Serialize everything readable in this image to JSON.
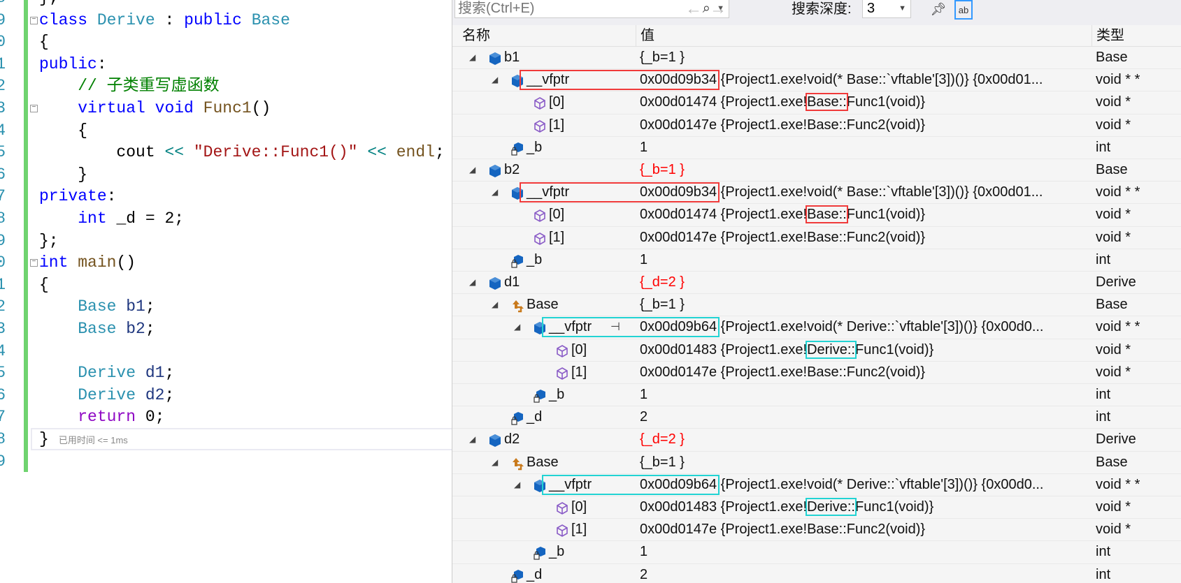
{
  "editor": {
    "line_numbers": [
      "8",
      "9",
      "0",
      "1",
      "2",
      "3",
      "4",
      "5",
      "6",
      "7",
      "8",
      "9",
      "0",
      "1",
      "2",
      "3",
      "4",
      "5",
      "6",
      "7",
      "8",
      "9"
    ],
    "fold_lines": [
      1,
      5,
      12
    ],
    "timing_hint": "已用时间 <= 1ms",
    "lines": [
      [
        [
          "pl",
          "};"
        ]
      ],
      [
        [
          "kw",
          "class "
        ],
        [
          "ty",
          "Derive"
        ],
        [
          "pl",
          " : "
        ],
        [
          "kw",
          "public "
        ],
        [
          "ty",
          "Base"
        ]
      ],
      [
        [
          "pl",
          "{"
        ]
      ],
      [
        [
          "kw",
          "public"
        ],
        [
          "pl",
          ":"
        ]
      ],
      [
        [
          "pl",
          "    "
        ],
        [
          "cm",
          "// 子类重写虚函数"
        ]
      ],
      [
        [
          "pl",
          "    "
        ],
        [
          "kw",
          "virtual void "
        ],
        [
          "fn",
          "Func1"
        ],
        [
          "pl",
          "()"
        ]
      ],
      [
        [
          "pl",
          "    {"
        ]
      ],
      [
        [
          "pl",
          "        cout "
        ],
        [
          "op",
          "<<"
        ],
        [
          "pl",
          " "
        ],
        [
          "st",
          "\"Derive::Func1()\""
        ],
        [
          "pl",
          " "
        ],
        [
          "op",
          "<<"
        ],
        [
          "pl",
          " "
        ],
        [
          "fn",
          "endl"
        ],
        [
          "pl",
          ";"
        ]
      ],
      [
        [
          "pl",
          "    }"
        ]
      ],
      [
        [
          "kw",
          "private"
        ],
        [
          "pl",
          ":"
        ]
      ],
      [
        [
          "pl",
          "    "
        ],
        [
          "kw",
          "int "
        ],
        [
          "pl",
          "_d = 2;"
        ]
      ],
      [
        [
          "pl",
          "};"
        ]
      ],
      [
        [
          "kw",
          "int "
        ],
        [
          "fn",
          "main"
        ],
        [
          "pl",
          "()"
        ]
      ],
      [
        [
          "pl",
          "{"
        ]
      ],
      [
        [
          "pl",
          "    "
        ],
        [
          "ty",
          "Base "
        ],
        [
          "va",
          "b1"
        ],
        [
          "pl",
          ";"
        ]
      ],
      [
        [
          "pl",
          "    "
        ],
        [
          "ty",
          "Base "
        ],
        [
          "va",
          "b2"
        ],
        [
          "pl",
          ";"
        ]
      ],
      [],
      [
        [
          "pl",
          "    "
        ],
        [
          "ty",
          "Derive "
        ],
        [
          "va",
          "d1"
        ],
        [
          "pl",
          ";"
        ]
      ],
      [
        [
          "pl",
          "    "
        ],
        [
          "ty",
          "Derive "
        ],
        [
          "va",
          "d2"
        ],
        [
          "pl",
          ";"
        ]
      ],
      [
        [
          "pl",
          "    "
        ],
        [
          "rt",
          "return "
        ],
        [
          "pl",
          "0;"
        ]
      ],
      [
        [
          "pl",
          "}"
        ]
      ],
      []
    ]
  },
  "toolbar": {
    "search_placeholder": "搜索(Ctrl+E)",
    "search_icon": "search-icon",
    "back_icon": "←",
    "forward_icon": "→",
    "depth_label": "搜索深度:",
    "depth_value": "3"
  },
  "columns": {
    "name": "名称",
    "value": "值",
    "type": "类型"
  },
  "colors": {
    "red_box": "#f03a3a",
    "cyan_box": "#22d3d3",
    "changed_value": "#ff0000"
  },
  "rows": [
    {
      "level": 0,
      "expand": true,
      "icon": "object",
      "name": "b1",
      "value": "{_b=1 }",
      "type": "Base"
    },
    {
      "level": 1,
      "expand": true,
      "icon": "object",
      "name": "__vfptr",
      "addr": "0x00d09b34",
      "rest": " {Project1.exe!void(* Base::`vftable'[3])()} {0x00d01...",
      "type": "void * *",
      "box": "red"
    },
    {
      "level": 2,
      "expand": false,
      "icon": "function",
      "name": "[0]",
      "addr": "0x00d01474",
      "pre": " {Project1.exe!",
      "mark": "Base::",
      "post": "Func1(void)}",
      "type": "void *",
      "mark_color": "red"
    },
    {
      "level": 2,
      "expand": false,
      "icon": "function",
      "name": "[1]",
      "value": "0x00d0147e {Project1.exe!Base::Func2(void)}",
      "type": "void *"
    },
    {
      "level": 1,
      "expand": false,
      "icon": "private-field",
      "name": "_b",
      "value": "1",
      "type": "int"
    },
    {
      "level": 0,
      "expand": true,
      "icon": "object",
      "name": "b2",
      "value": "{_b=1 }",
      "type": "Base",
      "changed": true
    },
    {
      "level": 1,
      "expand": true,
      "icon": "object",
      "name": "__vfptr",
      "addr": "0x00d09b34",
      "rest": " {Project1.exe!void(* Base::`vftable'[3])()} {0x00d01...",
      "type": "void * *",
      "box": "red"
    },
    {
      "level": 2,
      "expand": false,
      "icon": "function",
      "name": "[0]",
      "addr": "0x00d01474",
      "pre": " {Project1.exe!",
      "mark": "Base::",
      "post": "Func1(void)}",
      "type": "void *",
      "mark_color": "red"
    },
    {
      "level": 2,
      "expand": false,
      "icon": "function",
      "name": "[1]",
      "value": "0x00d0147e {Project1.exe!Base::Func2(void)}",
      "type": "void *"
    },
    {
      "level": 1,
      "expand": false,
      "icon": "private-field",
      "name": "_b",
      "value": "1",
      "type": "int"
    },
    {
      "level": 0,
      "expand": true,
      "icon": "object",
      "name": "d1",
      "value": "{_d=2 }",
      "type": "Derive",
      "changed": true
    },
    {
      "level": 1,
      "expand": true,
      "icon": "base-class",
      "name": "Base",
      "value": "{_b=1 }",
      "type": "Base"
    },
    {
      "level": 2,
      "expand": true,
      "icon": "object",
      "name": "__vfptr",
      "addr": "0x00d09b64",
      "rest": " {Project1.exe!void(* Derive::`vftable'[3])()} {0x00d0...",
      "type": "void * *",
      "box": "cyan",
      "pin": true
    },
    {
      "level": 3,
      "expand": false,
      "icon": "function",
      "name": "[0]",
      "addr": "0x00d01483",
      "pre": " {Project1.exe!",
      "mark": "Derive::",
      "post": "Func1(void)}",
      "type": "void *",
      "mark_color": "cyan"
    },
    {
      "level": 3,
      "expand": false,
      "icon": "function",
      "name": "[1]",
      "value": "0x00d0147e {Project1.exe!Base::Func2(void)}",
      "type": "void *"
    },
    {
      "level": 2,
      "expand": false,
      "icon": "private-field",
      "name": "_b",
      "value": "1",
      "type": "int"
    },
    {
      "level": 1,
      "expand": false,
      "icon": "private-field",
      "name": "_d",
      "value": "2",
      "type": "int"
    },
    {
      "level": 0,
      "expand": true,
      "icon": "object",
      "name": "d2",
      "value": "{_d=2 }",
      "type": "Derive",
      "changed": true
    },
    {
      "level": 1,
      "expand": true,
      "icon": "base-class",
      "name": "Base",
      "value": "{_b=1 }",
      "type": "Base"
    },
    {
      "level": 2,
      "expand": true,
      "icon": "object",
      "name": "__vfptr",
      "addr": "0x00d09b64",
      "rest": " {Project1.exe!void(* Derive::`vftable'[3])()} {0x00d0...",
      "type": "void * *",
      "box": "cyan"
    },
    {
      "level": 3,
      "expand": false,
      "icon": "function",
      "name": "[0]",
      "addr": "0x00d01483",
      "pre": " {Project1.exe!",
      "mark": "Derive::",
      "post": "Func1(void)}",
      "type": "void *",
      "mark_color": "cyan"
    },
    {
      "level": 3,
      "expand": false,
      "icon": "function",
      "name": "[1]",
      "value": "0x00d0147e {Project1.exe!Base::Func2(void)}",
      "type": "void *"
    },
    {
      "level": 2,
      "expand": false,
      "icon": "private-field",
      "name": "_b",
      "value": "1",
      "type": "int"
    },
    {
      "level": 1,
      "expand": false,
      "icon": "private-field",
      "name": "_d",
      "value": "2",
      "type": "int"
    }
  ]
}
